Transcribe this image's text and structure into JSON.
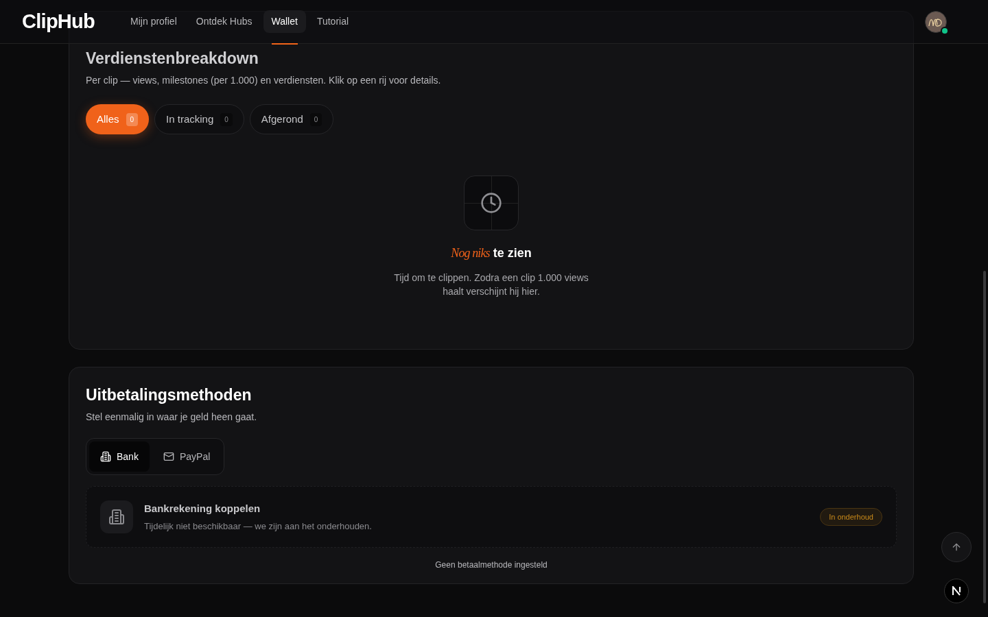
{
  "header": {
    "logo": "ClipHub",
    "nav": [
      {
        "label": "Mijn profiel",
        "selected": false
      },
      {
        "label": "Ontdek Hubs",
        "selected": false
      },
      {
        "label": "Wallet",
        "selected": true
      },
      {
        "label": "Tutorial",
        "selected": false
      }
    ],
    "avatar": {
      "online": true
    }
  },
  "earnings": {
    "title": "Verdienstenbreakdown",
    "subtitle": "Per clip — views, milestones (per 1.000) en verdiensten. Klik op een rij voor details.",
    "filters": [
      {
        "label": "Alles",
        "count": "0",
        "selected": true
      },
      {
        "label": "In tracking",
        "count": "0",
        "selected": false
      },
      {
        "label": "Afgerond",
        "count": "0",
        "selected": false
      }
    ],
    "empty": {
      "title": "*Nog niks* te zien",
      "text": "Tijd om te clippen. Zodra een clip 1.000 views haalt verschijnt hij hier."
    }
  },
  "payout": {
    "title": "Uitbetalingsmethoden",
    "subtitle": "Stel eenmalig in waar je geld heen gaat.",
    "tabs": [
      {
        "label": "Bank",
        "kind": "bank",
        "selected": true
      },
      {
        "label": "PayPal",
        "kind": "mail",
        "selected": false
      }
    ],
    "method": {
      "title": "Bankrekening koppelen",
      "text": "Tijdelijk niet beschikbaar — we zijn aan het onderhouden.",
      "badge": "In onderhoud"
    },
    "footer": "Geen betaalmethode ingesteld"
  }
}
